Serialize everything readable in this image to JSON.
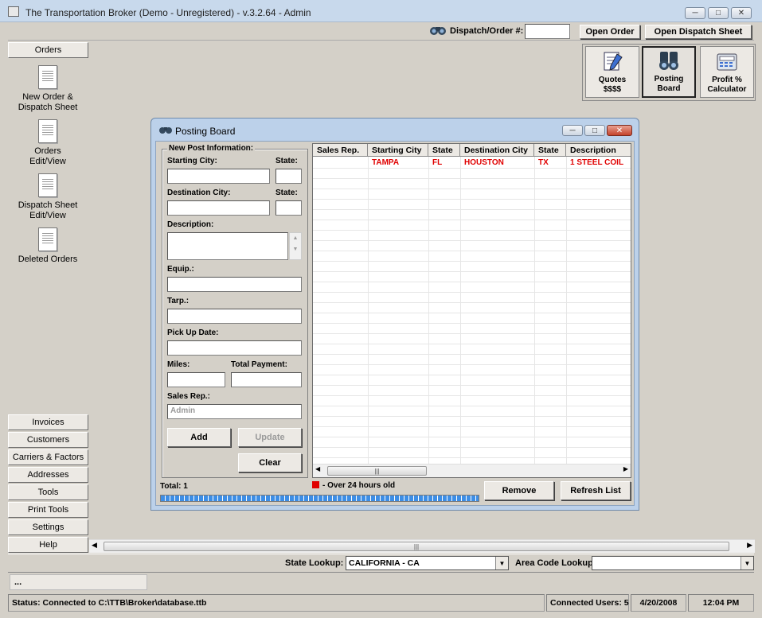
{
  "window": {
    "title": "The Transportation Broker (Demo - Unregistered) - v.3.2.64 - Admin"
  },
  "toolbar": {
    "dispatch_label": "Dispatch/Order #:",
    "dispatch_value": "",
    "open_order": "Open Order",
    "open_dispatch": "Open Dispatch Sheet"
  },
  "tools": {
    "quotes": [
      "Quotes",
      "$$$$"
    ],
    "posting": [
      "Posting",
      "Board"
    ],
    "profit": [
      "Profit %",
      "Calculator"
    ]
  },
  "sidebar": {
    "header": "Orders",
    "icons": [
      {
        "label1": "New Order &",
        "label2": "Dispatch Sheet",
        "icon": "document-icon"
      },
      {
        "label1": "Orders",
        "label2": "Edit/View",
        "icon": "document-edit-icon"
      },
      {
        "label1": "Dispatch Sheet",
        "label2": "Edit/View",
        "icon": "document-edit-icon"
      },
      {
        "label1": "Deleted Orders",
        "label2": "",
        "icon": "document-icon"
      }
    ],
    "tabs": [
      "Invoices",
      "Customers",
      "Carriers & Factors",
      "Addresses",
      "Tools",
      "Print Tools",
      "Settings",
      "Help"
    ]
  },
  "dialog": {
    "title": "Posting Board",
    "group_title": "New Post Information:",
    "starting_city": "Starting City:",
    "state": "State:",
    "destination_city": "Destination City:",
    "description": "Description:",
    "equip": "Equip.:",
    "tarp": "Tarp.:",
    "pickup_date": "Pick Up Date:",
    "miles": "Miles:",
    "total_payment": "Total Payment:",
    "sales_rep": "Sales Rep.:",
    "sales_rep_placeholder": "Admin",
    "add": "Add",
    "update": "Update",
    "clear": "Clear",
    "total": "Total: 1",
    "legend": "- Over 24 hours old",
    "legend_color": "#e00000",
    "remove": "Remove",
    "refresh": "Refresh List",
    "columns": [
      "Sales Rep.",
      "Starting City",
      "State",
      "Destination City",
      "State",
      "Description"
    ],
    "rows": [
      {
        "rep": "",
        "start": "TAMPA",
        "state1": "FL",
        "dest": "HOUSTON",
        "state2": "TX",
        "desc": "1 STEEL COIL"
      }
    ]
  },
  "bottom": {
    "state_lookup_label": "State Lookup:",
    "state_lookup_value": "CALIFORNIA - CA",
    "area_code_label": "Area Code Lookup:",
    "area_code_value": "",
    "message": "..."
  },
  "status": {
    "connection": "Status: Connected to C:\\TTB\\Broker\\database.ttb",
    "users": "Connected Users: 5",
    "date": "4/20/2008",
    "time": "12:04 PM"
  }
}
